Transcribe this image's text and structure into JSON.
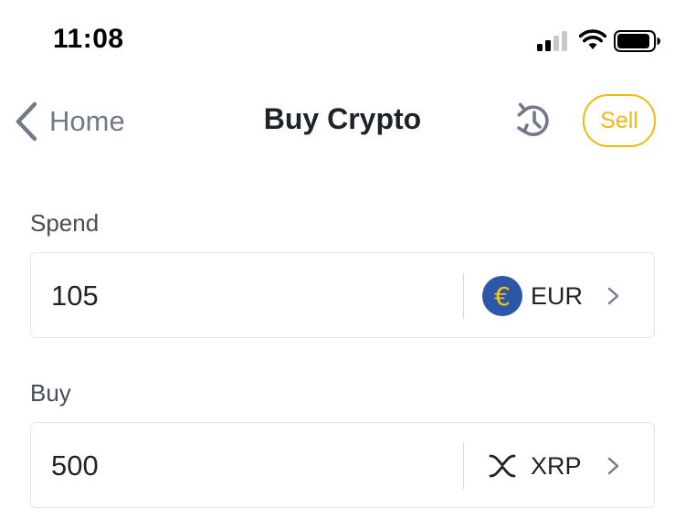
{
  "status_bar": {
    "time": "11:08",
    "icons": [
      "signal-icon",
      "wifi-icon",
      "battery-icon"
    ]
  },
  "nav": {
    "back_label": "Home",
    "title": "Buy Crypto",
    "history_icon": "history-icon",
    "sell_label": "Sell"
  },
  "spend": {
    "label": "Spend",
    "value": "105",
    "currency_symbol": "€",
    "currency_code": "EUR"
  },
  "buy": {
    "label": "Buy",
    "value": "500",
    "currency_code": "XRP",
    "currency_icon": "xrp-icon"
  },
  "colors": {
    "accent": "#f0b90b",
    "text_primary": "#1e2329",
    "text_secondary": "#707a8a",
    "eur_badge": "#2d56a8",
    "border": "#e3e5e8"
  }
}
